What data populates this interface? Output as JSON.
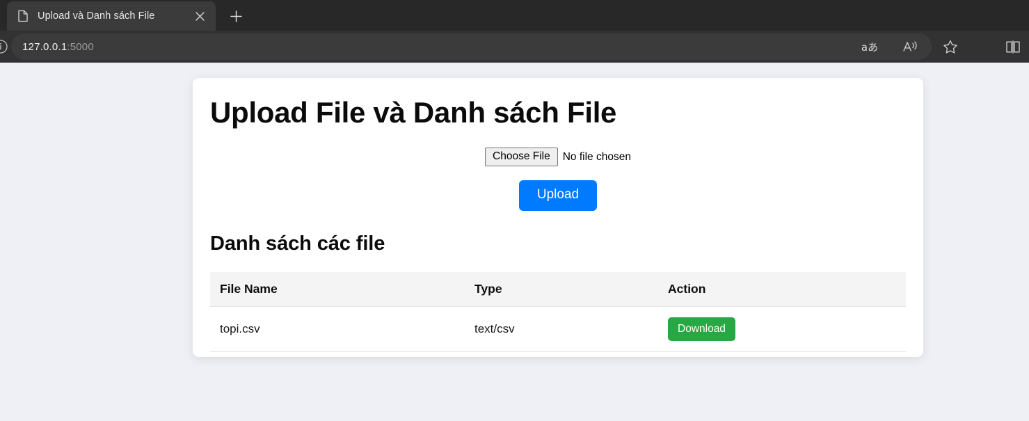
{
  "browser": {
    "tab": {
      "title": "Upload và Danh sách File",
      "favicon_name": "page-icon",
      "close_label": "×"
    },
    "new_tab_label": "+",
    "address": {
      "host": "127.0.0.1",
      "port": ":5000"
    },
    "actions": [
      {
        "name": "translate-icon",
        "glyph": "aあ"
      },
      {
        "name": "read-aloud-icon",
        "glyph": ""
      },
      {
        "name": "favorites-icon",
        "glyph": ""
      }
    ],
    "split_screen_name": "split-screen-icon"
  },
  "page": {
    "title": "Upload File và Danh sách File",
    "upload_form": {
      "choose_file_label": "Choose File",
      "no_file_text": "No file chosen",
      "upload_label": "Upload"
    },
    "file_list": {
      "section_title": "Danh sách các file",
      "columns": [
        "File Name",
        "Type",
        "Action"
      ],
      "rows": [
        {
          "file_name": "topi.csv",
          "type": "text/csv",
          "action_label": "Download"
        }
      ]
    }
  },
  "colors": {
    "page_background": "#eff0f5",
    "card_background": "#ffffff",
    "upload_button": "#007bff",
    "download_button": "#28a745",
    "table_header": "#f4f4f5",
    "chrome_tabstrip": "#282828",
    "chrome_toolbar": "#323232"
  }
}
